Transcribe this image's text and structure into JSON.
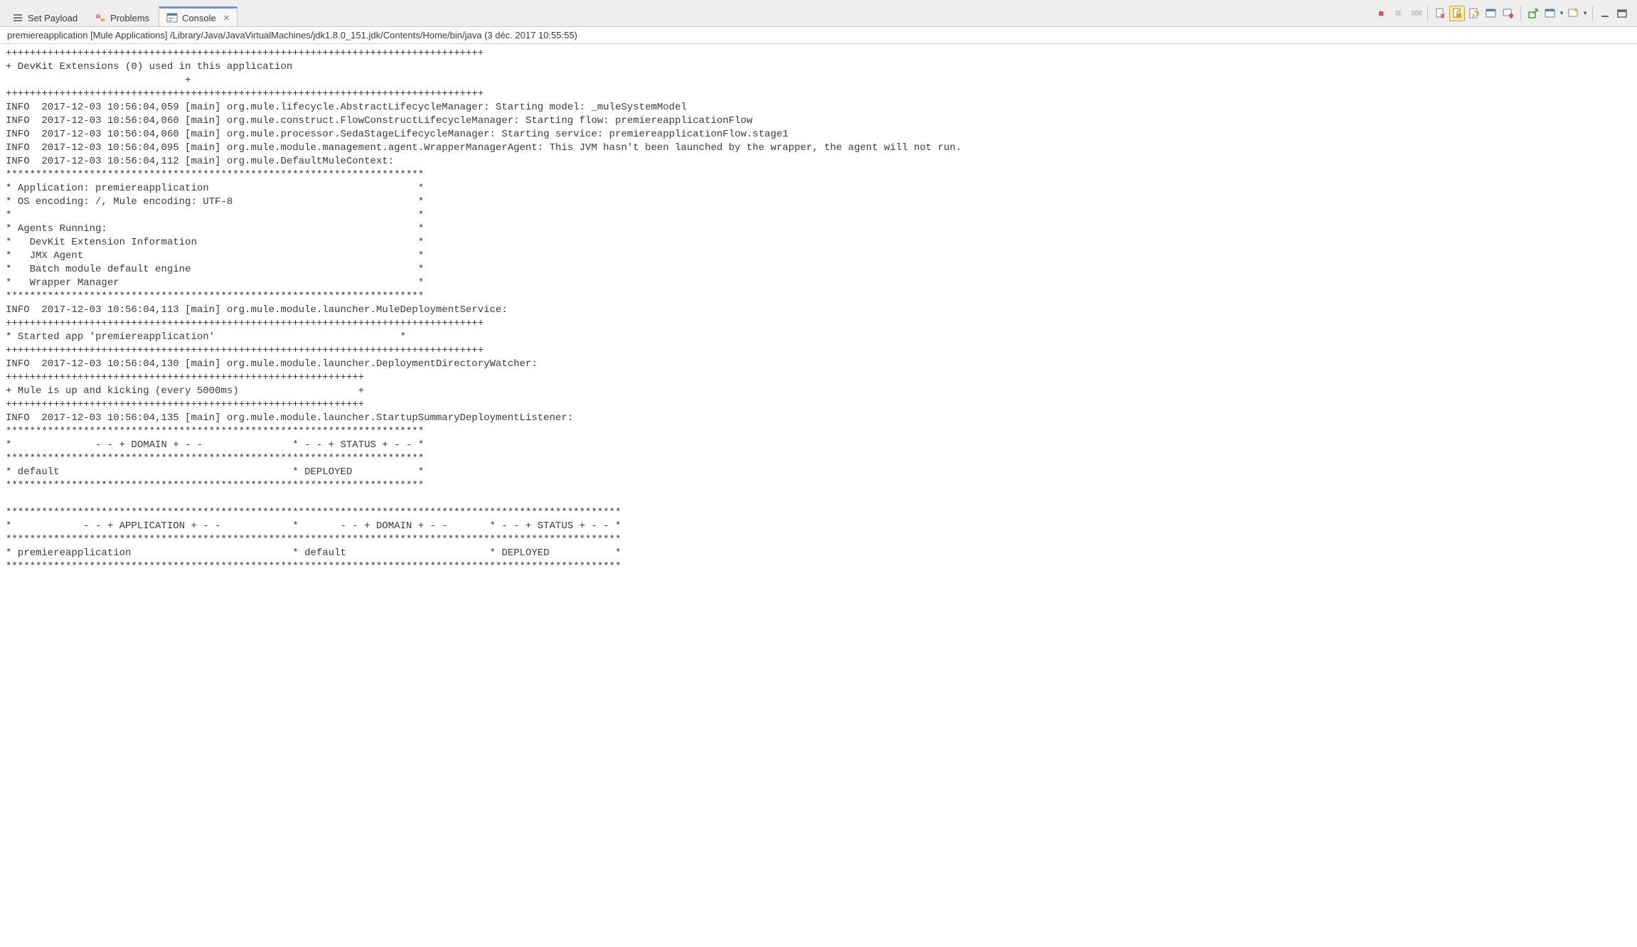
{
  "tabs": [
    {
      "label": "Set Payload",
      "icon": "list-icon"
    },
    {
      "label": "Problems",
      "icon": "problems-icon"
    },
    {
      "label": "Console",
      "icon": "console-icon",
      "active": true
    }
  ],
  "toolbar_icons": {
    "terminate": "■",
    "remove1": "✖",
    "remove2": "✖✖",
    "doc_remove": "doc-x",
    "scroll_lock": "lock-doc",
    "word_wrap": "wrap",
    "clear": "clear",
    "pin": "📌",
    "export": "↗",
    "new_console_dd": "□",
    "view_menu_dd": "□",
    "minimize": "—",
    "maximize": "▭"
  },
  "status": "premiereapplication [Mule Applications] /Library/Java/JavaVirtualMachines/jdk1.8.0_151.jdk/Contents/Home/bin/java (3 déc. 2017 10:55:55)",
  "console_lines": [
    "++++++++++++++++++++++++++++++++++++++++++++++++++++++++++++++++++++++++++++++++",
    "+ DevKit Extensions (0) used in this application",
    "                              +",
    "++++++++++++++++++++++++++++++++++++++++++++++++++++++++++++++++++++++++++++++++",
    "INFO  2017-12-03 10:56:04,059 [main] org.mule.lifecycle.AbstractLifecycleManager: Starting model: _muleSystemModel",
    "INFO  2017-12-03 10:56:04,060 [main] org.mule.construct.FlowConstructLifecycleManager: Starting flow: premiereapplicationFlow",
    "INFO  2017-12-03 10:56:04,060 [main] org.mule.processor.SedaStageLifecycleManager: Starting service: premiereapplicationFlow.stage1",
    "INFO  2017-12-03 10:56:04,095 [main] org.mule.module.management.agent.WrapperManagerAgent: This JVM hasn't been launched by the wrapper, the agent will not run.",
    "INFO  2017-12-03 10:56:04,112 [main] org.mule.DefaultMuleContext: ",
    "**********************************************************************",
    "* Application: premiereapplication                                   *",
    "* OS encoding: /, Mule encoding: UTF-8                               *",
    "*                                                                    *",
    "* Agents Running:                                                    *",
    "*   DevKit Extension Information                                     *",
    "*   JMX Agent                                                        *",
    "*   Batch module default engine                                      *",
    "*   Wrapper Manager                                                  *",
    "**********************************************************************",
    "INFO  2017-12-03 10:56:04,113 [main] org.mule.module.launcher.MuleDeploymentService: ",
    "++++++++++++++++++++++++++++++++++++++++++++++++++++++++++++++++++++++++++++++++",
    "* Started app 'premiereapplication'                               *",
    "++++++++++++++++++++++++++++++++++++++++++++++++++++++++++++++++++++++++++++++++",
    "INFO  2017-12-03 10:56:04,130 [main] org.mule.module.launcher.DeploymentDirectoryWatcher: ",
    "++++++++++++++++++++++++++++++++++++++++++++++++++++++++++++",
    "+ Mule is up and kicking (every 5000ms)                    +",
    "++++++++++++++++++++++++++++++++++++++++++++++++++++++++++++",
    "INFO  2017-12-03 10:56:04,135 [main] org.mule.module.launcher.StartupSummaryDeploymentListener: ",
    "**********************************************************************",
    "*              - - + DOMAIN + - -               * - - + STATUS + - - *",
    "**********************************************************************",
    "* default                                       * DEPLOYED           *",
    "**********************************************************************",
    "",
    "*******************************************************************************************************",
    "*            - - + APPLICATION + - -            *       - - + DOMAIN + - -       * - - + STATUS + - - *",
    "*******************************************************************************************************",
    "* premiereapplication                           * default                        * DEPLOYED           *",
    "*******************************************************************************************************"
  ]
}
